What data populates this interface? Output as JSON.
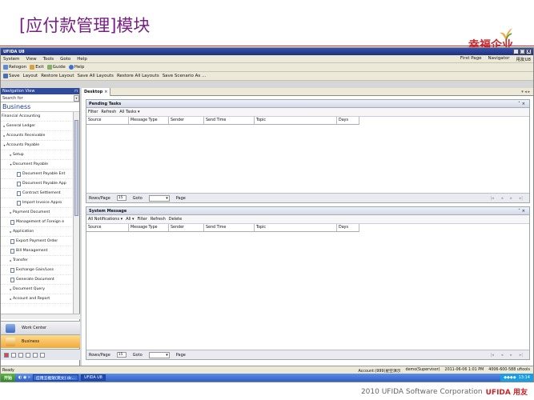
{
  "slide": {
    "title": "[应付款管理]模块",
    "brand_top": "幸福企业",
    "footer_copyright": "2010 UFIDA Software Corporation",
    "footer_brand": "UFIDA 用友"
  },
  "window": {
    "title": "UFIDA U8",
    "controls": [
      "_",
      "□",
      "X"
    ]
  },
  "menubar": {
    "items": [
      "System",
      "View",
      "Tools",
      "Goto",
      "Help"
    ],
    "right": [
      "First Page",
      "Navigator",
      "用友U8"
    ]
  },
  "toolbar1": {
    "items": [
      "Relogon",
      "Exit",
      "Guide",
      "Help"
    ]
  },
  "toolbar2": {
    "items": [
      "Save",
      "Layout",
      "Restore Layout",
      "Save All Layouts",
      "Restore All Layouts",
      "Save Scenario As ..."
    ]
  },
  "nav": {
    "header": "Navigation View",
    "search_placeholder": "Search for",
    "business_title": "Business",
    "tree": [
      {
        "label": "Financial Accounting",
        "level": 0,
        "type": "section"
      },
      {
        "label": "General Ledger",
        "level": 1,
        "type": "collapsed"
      },
      {
        "label": "Accounts Receivable",
        "level": 1,
        "type": "collapsed"
      },
      {
        "label": "Accounts Payable",
        "level": 1,
        "type": "expanded"
      },
      {
        "label": "Setup",
        "level": 2,
        "type": "collapsed"
      },
      {
        "label": "Document Payable",
        "level": 2,
        "type": "expanded"
      },
      {
        "label": "Document Payable Ent",
        "level": 3,
        "type": "doc"
      },
      {
        "label": "Document Payable App",
        "level": 3,
        "type": "doc"
      },
      {
        "label": "Contract Settlement",
        "level": 3,
        "type": "doc"
      },
      {
        "label": "Import Invoice Appro",
        "level": 3,
        "type": "doc"
      },
      {
        "label": "Payment Document",
        "level": 2,
        "type": "collapsed"
      },
      {
        "label": "Management of Foreign e",
        "level": 2,
        "type": "doc"
      },
      {
        "label": "Application",
        "level": 2,
        "type": "collapsed"
      },
      {
        "label": "Export Payment Order",
        "level": 2,
        "type": "doc"
      },
      {
        "label": "Bill Management",
        "level": 2,
        "type": "doc"
      },
      {
        "label": "Transfer",
        "level": 2,
        "type": "collapsed"
      },
      {
        "label": "Exchange Gain/Loss",
        "level": 2,
        "type": "doc"
      },
      {
        "label": "Generate Document",
        "level": 2,
        "type": "doc"
      },
      {
        "label": "Document Query",
        "level": 2,
        "type": "collapsed"
      },
      {
        "label": "Account and Report",
        "level": 2,
        "type": "collapsed"
      }
    ],
    "work_center": "Work Center",
    "business_btn": "Business"
  },
  "content": {
    "tab": "Desktop",
    "pending": {
      "title": "Pending Tasks",
      "toolbar": [
        "Filter",
        "Refresh",
        "All Tasks ▾"
      ],
      "columns": [
        "Source",
        "Message Type",
        "Sender",
        "Send Time",
        "Topic",
        "Days"
      ],
      "rows_label": "Rows/Page",
      "rows_value": "15",
      "goto_label": "Goto",
      "page_label": "Page"
    },
    "system": {
      "title": "System Message",
      "toolbar": [
        "All Notifications ▾",
        "All ▾",
        "Filter",
        "Refresh",
        "Delete"
      ],
      "columns": [
        "Source",
        "Message Type",
        "Sender",
        "Send Time",
        "Topic",
        "Days"
      ],
      "rows_label": "Rows/Page",
      "rows_value": "15",
      "goto_label": "Goto",
      "page_label": "Page"
    }
  },
  "statusbar": {
    "left": "Ready",
    "account": "Account:(999)星空演示",
    "user": "demo(Supervisor)",
    "datetime": "2011-06-06 1:01 PM",
    "phone": "4006-600-588 uftools"
  },
  "taskbar": {
    "start": "开始",
    "tasks": [
      "应用王框架(英文) dc...",
      "UFIDA U8"
    ],
    "time": "13:14"
  },
  "colors": {
    "title_purple": "#7a1f87",
    "brand_red": "#c8262a",
    "nav_header_blue": "#2d4a9b",
    "business_orange": "#f2a93b"
  }
}
